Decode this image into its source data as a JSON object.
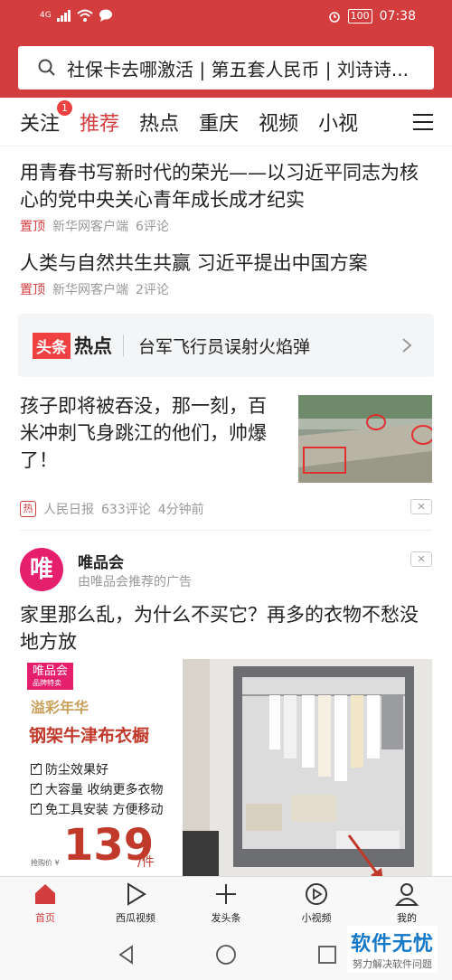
{
  "status": {
    "network": "4G",
    "battery": "100",
    "time": "07:38"
  },
  "search": {
    "text": "社保卡去哪激活 | 第五套人民币 | 刘诗诗..."
  },
  "tabs": [
    {
      "label": "关注",
      "badge": "1"
    },
    {
      "label": "推荐"
    },
    {
      "label": "热点"
    },
    {
      "label": "重庆"
    },
    {
      "label": "视频"
    },
    {
      "label": "小视"
    }
  ],
  "feed": {
    "item1": {
      "title": "用青春书写新时代的荣光——以习近平同志为核心的党中央关心青年成长成才纪实",
      "pin": "置顶",
      "source": "新华网客户端",
      "comments": "6评论"
    },
    "item2": {
      "title": "人类与自然共生共赢 习近平提出中国方案",
      "pin": "置顶",
      "source": "新华网客户端",
      "comments": "2评论"
    },
    "hot": {
      "logo_a": "头条",
      "logo_b": "热点",
      "text": "台军飞行员误射火焰弹"
    },
    "item3": {
      "title": "孩子即将被吞没，那一刻，百米冲刺飞身跳江的他们，帅爆了！",
      "tag": "热",
      "source": "人民日报",
      "comments": "633评论",
      "time": "4分钟前"
    },
    "ad": {
      "logo": "唯",
      "brand": "唯品会",
      "sub": "由唯品会推荐的广告",
      "title": "家里那么乱，为什么不买它？再多的衣物不愁没地方放",
      "badge": "唯品会",
      "badge_sub": "品牌特卖",
      "brand2": "溢彩年华",
      "product": "钢架牛津布衣橱",
      "features": [
        "防尘效果好",
        "大容量 收纳更多衣物",
        "免工具安装 方便移动"
      ],
      "price_label": "抢购价 ¥",
      "price": "139",
      "unit": "/件"
    }
  },
  "nav": [
    {
      "label": "首页"
    },
    {
      "label": "西瓜视频"
    },
    {
      "label": "发头条"
    },
    {
      "label": "小视频"
    },
    {
      "label": "我的"
    }
  ],
  "watermark": {
    "line1": "软件无忧",
    "line2": "努力解决软件问题"
  },
  "colors": {
    "brand": "#d43d3d",
    "hot": "#f04142",
    "vip": "#e61e6e"
  }
}
